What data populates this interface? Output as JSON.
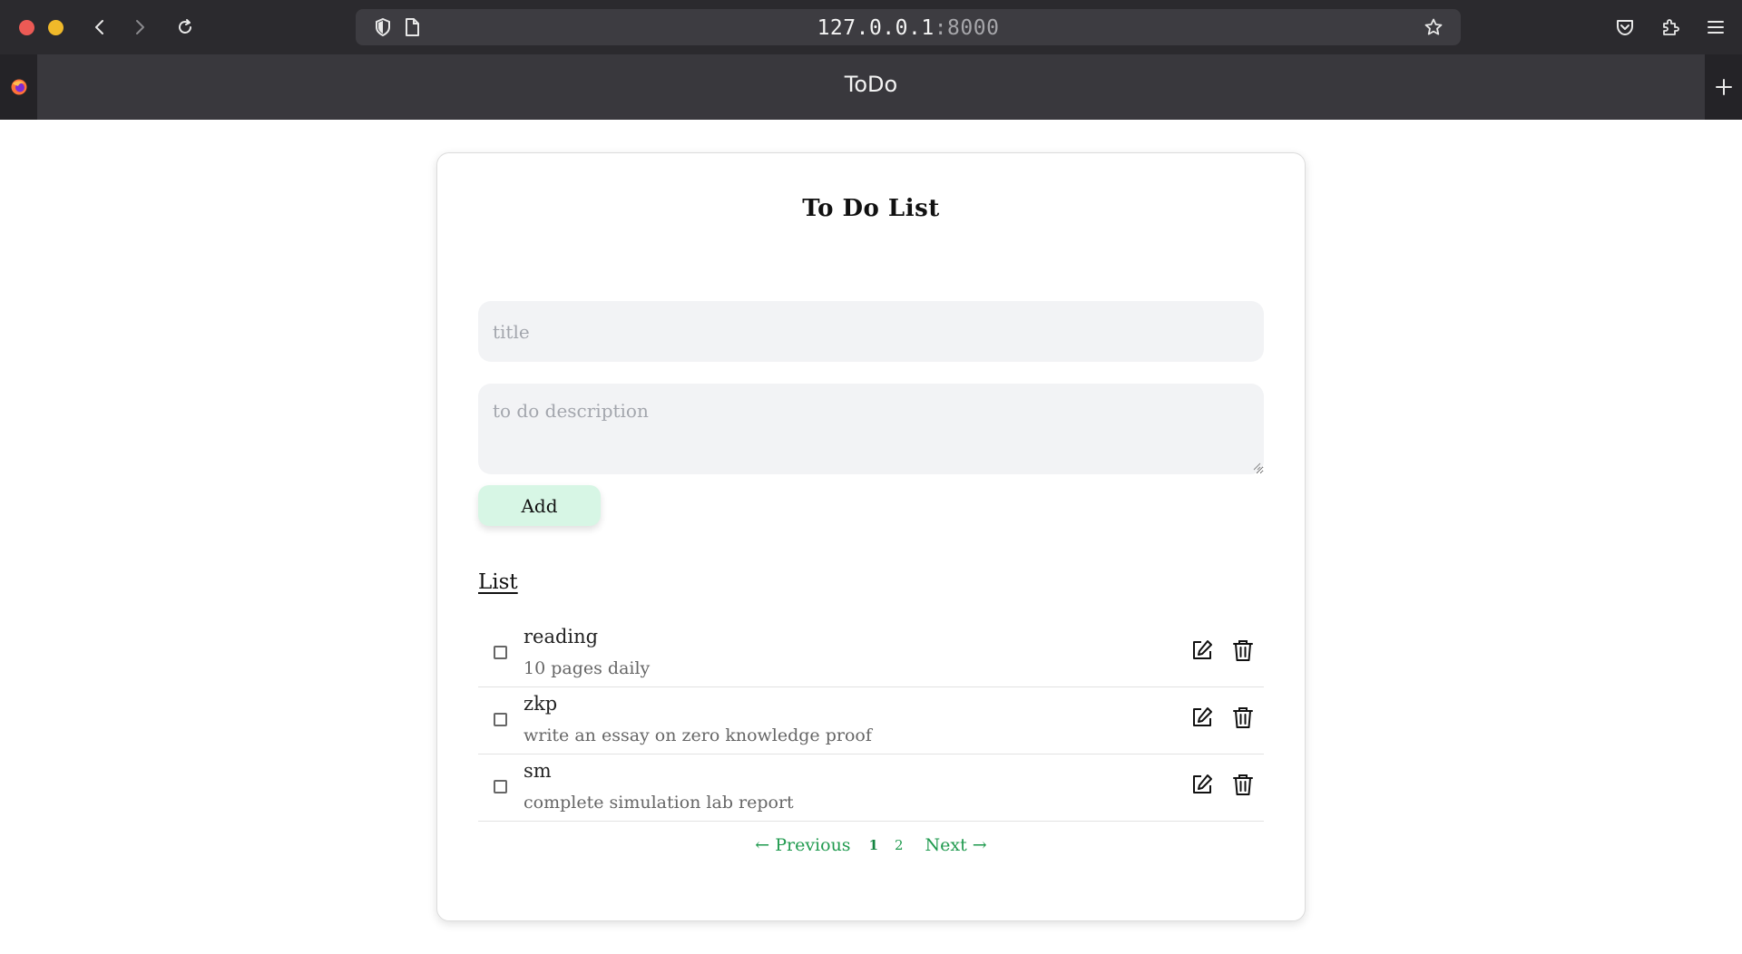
{
  "browser": {
    "url_host": "127.0.0.1",
    "url_port": ":8000",
    "tab_title": "ToDo"
  },
  "page": {
    "heading": "To Do List",
    "title_placeholder": "title",
    "description_placeholder": "to do description",
    "add_label": "Add",
    "list_heading": "List",
    "items": [
      {
        "title": "reading",
        "description": "10 pages daily",
        "done": false
      },
      {
        "title": "zkp",
        "description": "write an essay on zero knowledge proof",
        "done": false
      },
      {
        "title": "sm",
        "description": "complete simulation lab report",
        "done": false
      }
    ],
    "pagination": {
      "previous_label": "← Previous",
      "pages": [
        "1",
        "2"
      ],
      "current_page": "1",
      "next_label": "Next →"
    }
  },
  "colors": {
    "accent": "#1f9a4e",
    "add_button_bg": "#d7f6e5",
    "input_bg": "#f2f3f5"
  }
}
